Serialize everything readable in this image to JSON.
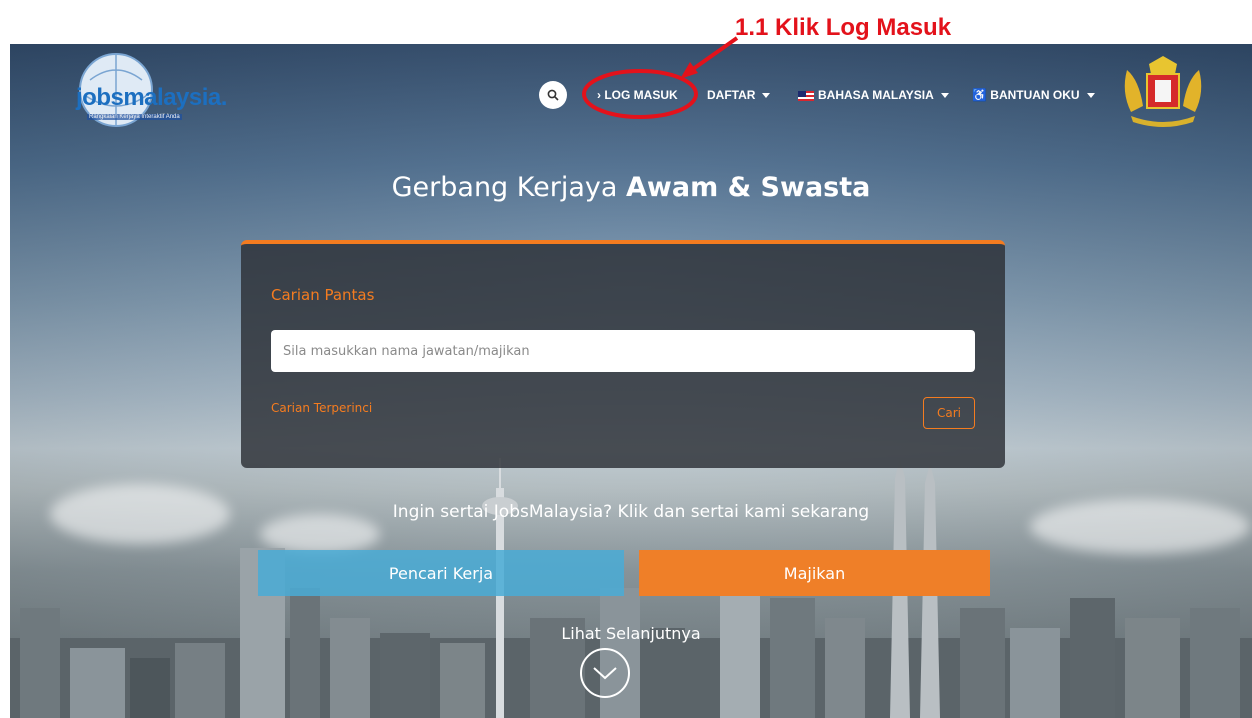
{
  "annotation": {
    "step_label": "1.1  Klik Log Masuk",
    "color": "#e3121b"
  },
  "logo": {
    "text": "jobsmalaysia.",
    "tagline": "Rangkaian Kerjaya Interaktif Anda"
  },
  "nav": {
    "search_icon": "search-icon",
    "login_label": "› LOG MASUK",
    "register_label": "DAFTAR",
    "language_label": "BAHASA MALAYSIA",
    "accessibility_label": "♿ BANTUAN OKU"
  },
  "hero": {
    "heading_normal": "Gerbang Kerjaya ",
    "heading_bold": "Awam & Swasta"
  },
  "quick_search": {
    "title": "Carian Pantas",
    "placeholder": "Sila masukkan nama jawatan/majikan",
    "advanced_link": "Carian Terperinci",
    "search_button": "Cari"
  },
  "join": {
    "prompt": "Ingin sertai JobsMalaysia? Klik dan sertai kami sekarang",
    "job_seeker_button": "Pencari Kerja",
    "employer_button": "Majikan"
  },
  "see_more": {
    "label": "Lihat Selanjutnya"
  },
  "colors": {
    "accent_orange": "#f47c20",
    "seeker_blue": "#49abd6",
    "annotation_red": "#e3121b"
  }
}
